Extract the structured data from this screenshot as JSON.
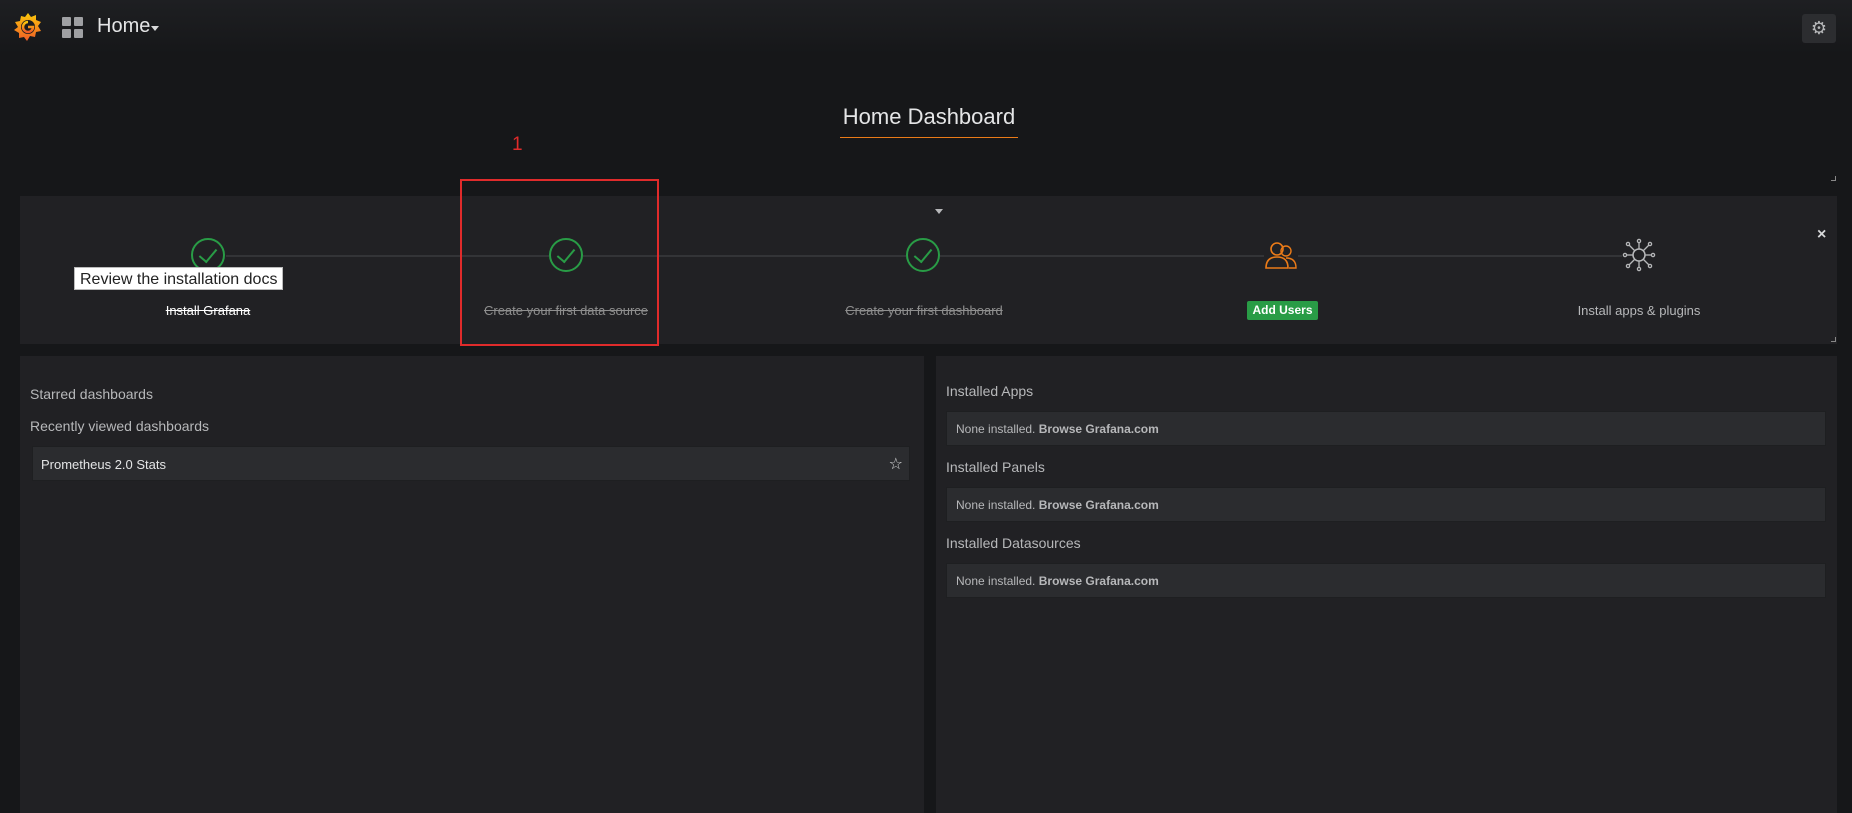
{
  "nav": {
    "home_label": "Home",
    "settings_icon": "gear-icon"
  },
  "dashboard": {
    "title": "Home Dashboard",
    "annotation": "1"
  },
  "getting_started": {
    "tooltip": "Review the installation docs",
    "steps": [
      {
        "label": "Install Grafana",
        "state": "done",
        "icon": "check-circle-icon"
      },
      {
        "label": "Create your first data source",
        "state": "done",
        "icon": "check-circle-icon"
      },
      {
        "label": "Create your first dashboard",
        "state": "done",
        "icon": "check-circle-icon"
      },
      {
        "label": "Add Users",
        "state": "active",
        "icon": "users-icon"
      },
      {
        "label": "Install apps & plugins",
        "state": "todo",
        "icon": "plugins-icon"
      }
    ],
    "close_symbol": "×"
  },
  "left_panel": {
    "starred_heading": "Starred dashboards",
    "recent_heading": "Recently viewed dashboards",
    "recent_items": [
      {
        "title": "Prometheus 2.0 Stats"
      }
    ]
  },
  "right_panel": {
    "sections": [
      {
        "heading": "Installed Apps",
        "text": "None installed.",
        "link": "Browse Grafana.com"
      },
      {
        "heading": "Installed Panels",
        "text": "None installed.",
        "link": "Browse Grafana.com"
      },
      {
        "heading": "Installed Datasources",
        "text": "None installed.",
        "link": "Browse Grafana.com"
      }
    ]
  },
  "colors": {
    "accent_orange": "#eb7b18",
    "success_green": "#299c46",
    "annotation_red": "#e02b2b"
  }
}
